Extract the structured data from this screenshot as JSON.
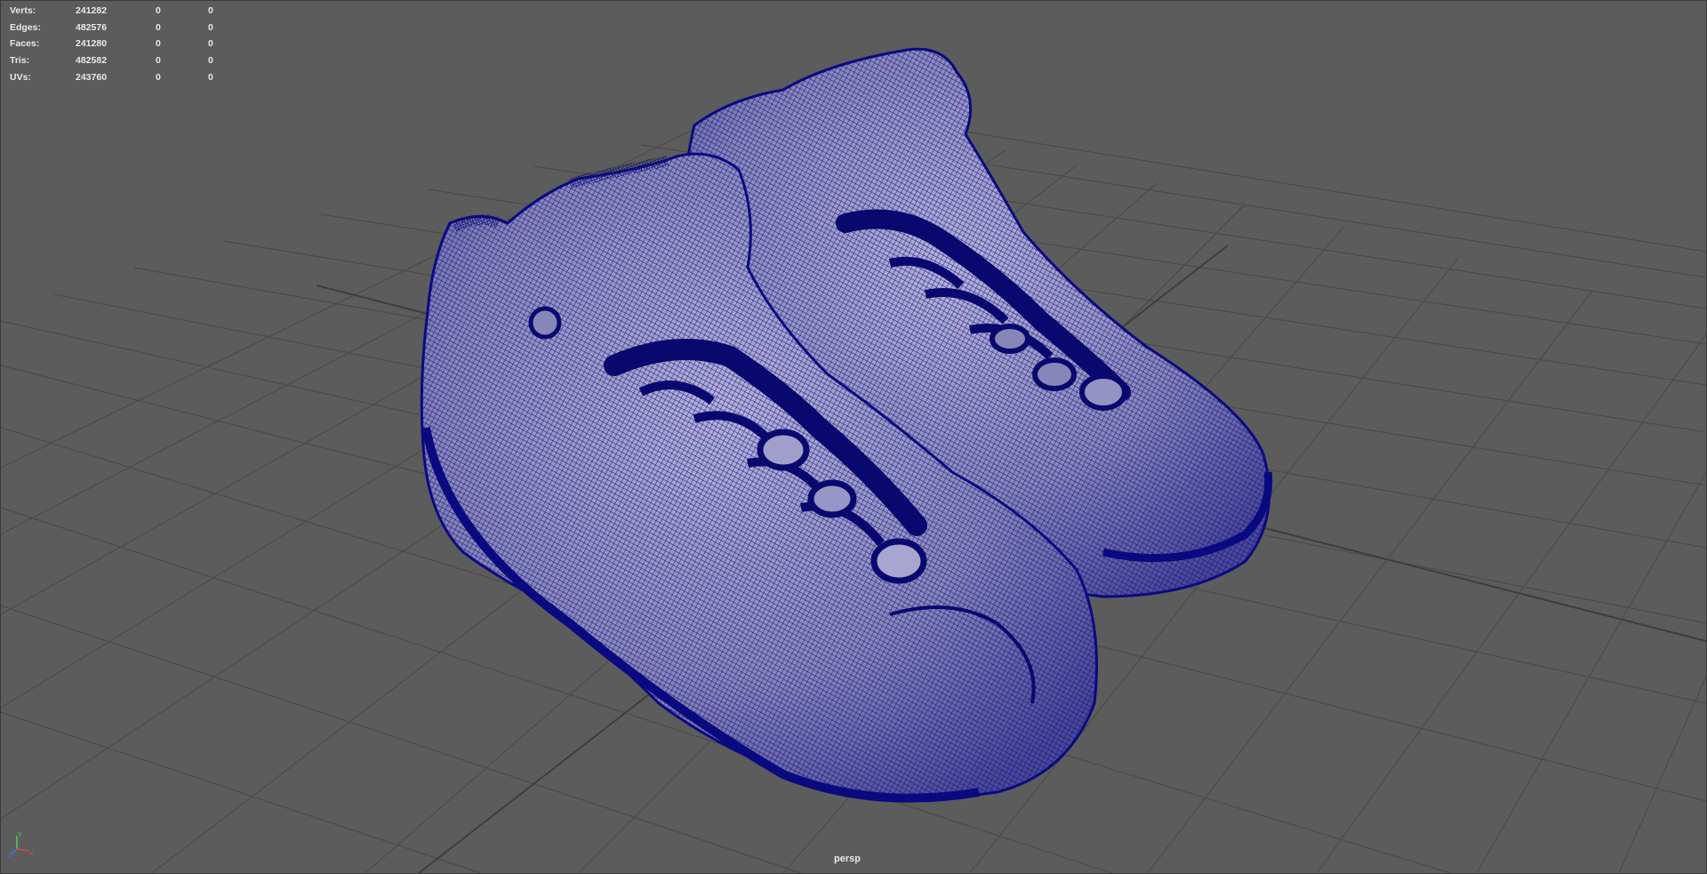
{
  "hud": {
    "rows": [
      {
        "label": "Verts:",
        "value": "241282",
        "selected": "0",
        "component": "0"
      },
      {
        "label": "Edges:",
        "value": "482576",
        "selected": "0",
        "component": "0"
      },
      {
        "label": "Faces:",
        "value": "241280",
        "selected": "0",
        "component": "0"
      },
      {
        "label": "Tris:",
        "value": "482582",
        "selected": "0",
        "component": "0"
      },
      {
        "label": "UVs:",
        "value": "243760",
        "selected": "0",
        "component": "0"
      }
    ]
  },
  "viewport": {
    "camera": "persp",
    "background_color": "#5c5c5c",
    "grid_color": "#4a4a4a",
    "wire_color": "#0a0a80",
    "surface_color": "#8a88b8"
  },
  "objects": [
    {
      "name": "hiking-boot-left",
      "type": "polygon-mesh-wireframe"
    },
    {
      "name": "hiking-boot-right",
      "type": "polygon-mesh-wireframe"
    }
  ],
  "axis_gizmo": {
    "labels": [
      "Y",
      "Z",
      "X"
    ]
  }
}
